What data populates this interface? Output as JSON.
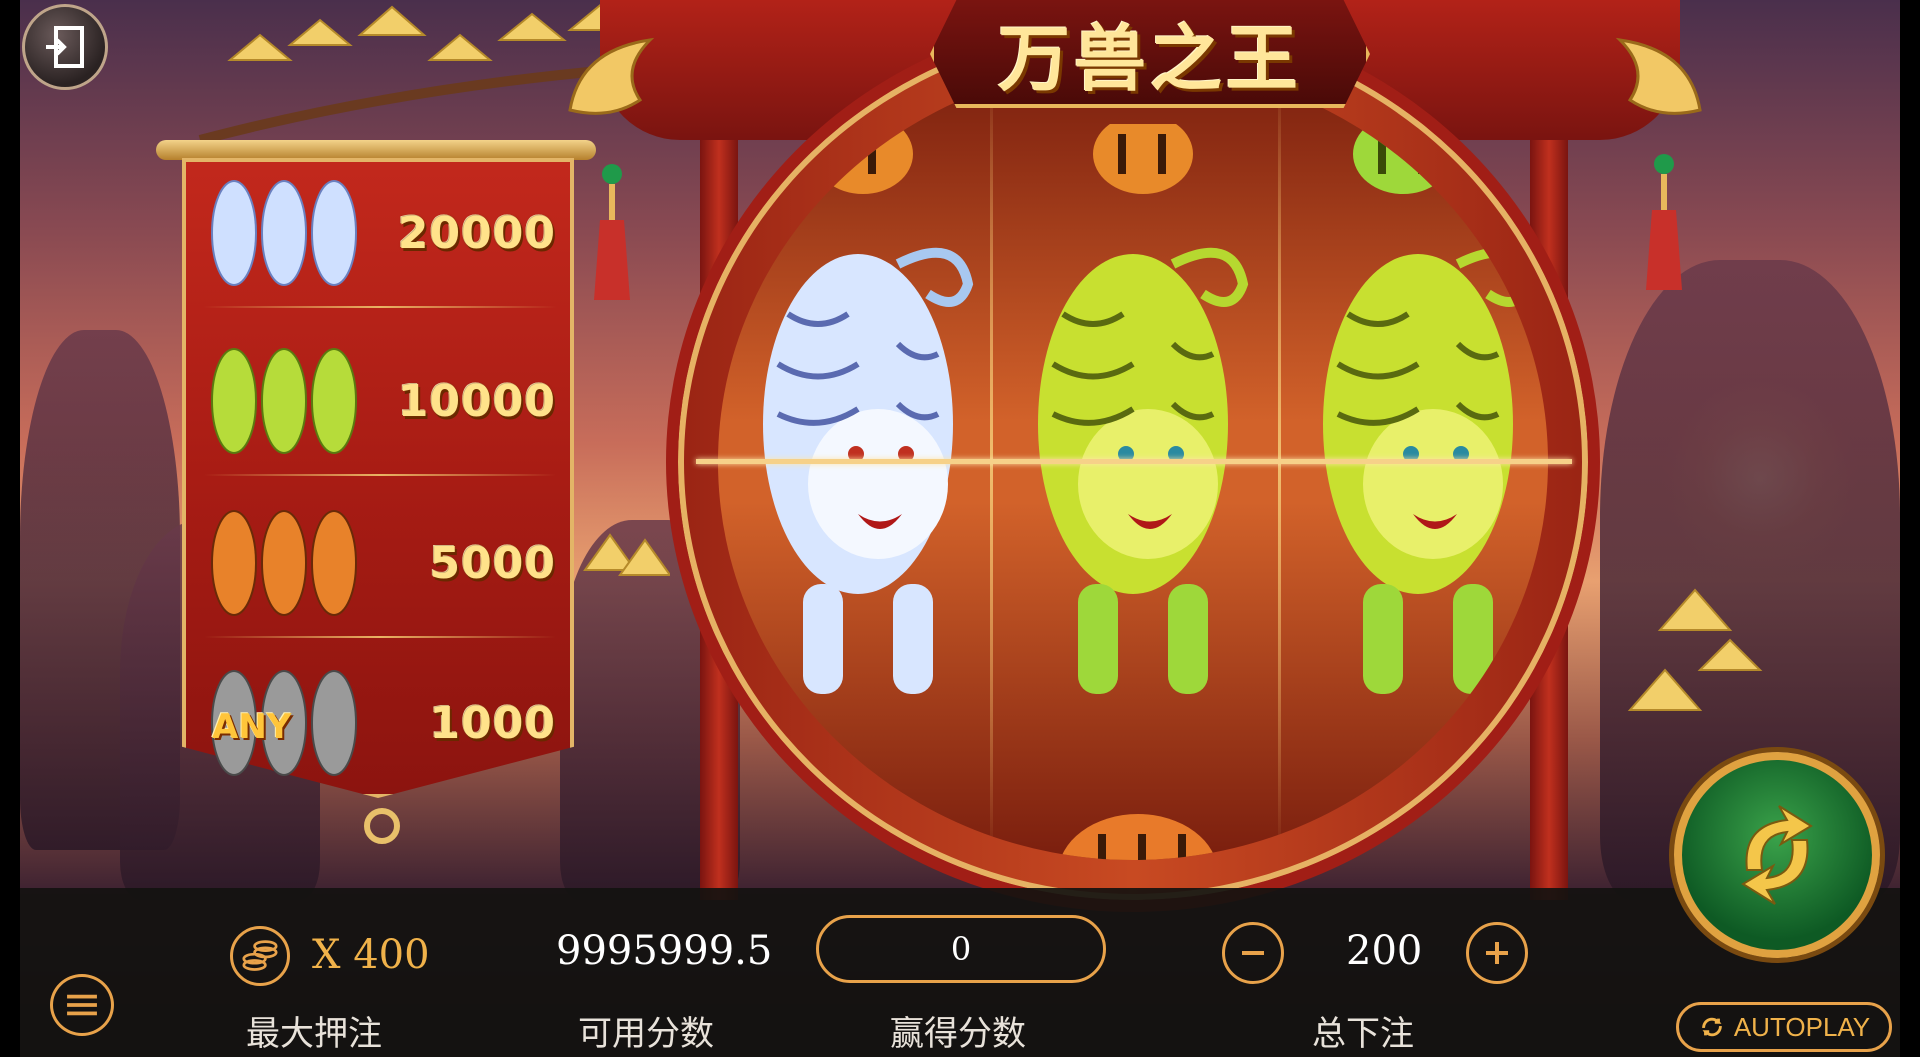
{
  "game": {
    "title": "万兽之王"
  },
  "paytable": {
    "rows": [
      {
        "symbol": "white-tiger",
        "amount": "20000"
      },
      {
        "symbol": "green-tiger",
        "amount": "10000"
      },
      {
        "symbol": "orange-tiger",
        "amount": "5000"
      },
      {
        "symbol": "any-tiger",
        "label": "ANY",
        "amount": "1000"
      }
    ]
  },
  "reels": {
    "center_line": [
      "white-tiger",
      "green-tiger",
      "green-tiger"
    ]
  },
  "bottom_bar": {
    "max_bet_multiplier": "X 400",
    "max_bet_label": "最大押注",
    "balance_value": "9995999.5",
    "balance_label": "可用分数",
    "win_value": "0",
    "win_label": "赢得分数",
    "total_bet_value": "200",
    "total_bet_label": "总下注",
    "autoplay_label": "AUTOPLAY"
  },
  "colors": {
    "accent_gold": "#e8a24a",
    "banner_red": "#a81c14",
    "spin_green": "#1f7a34"
  }
}
